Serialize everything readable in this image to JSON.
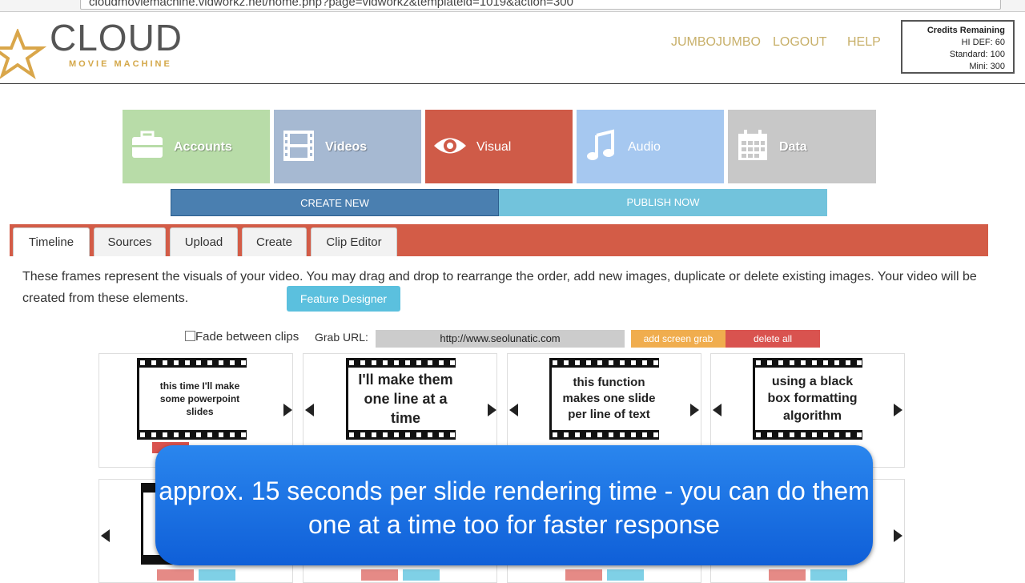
{
  "browser": {
    "url": "cloudmoviemachine.vidworkz.net/home.php?page=vidworkz&templateid=1019&action=300"
  },
  "logo": {
    "name": "CLOUD",
    "tagline": "MOVIE MACHINE"
  },
  "nav": {
    "user": "JUMBOJUMBO",
    "logout": "LOGOUT",
    "help": "HELP"
  },
  "credits": {
    "title": "Credits Remaining",
    "hidef": "HI DEF: 60",
    "standard": "Standard: 100",
    "mini": "Mini: 300"
  },
  "tiles": [
    {
      "label": "Accounts",
      "icon": "briefcase-icon",
      "color": "#b8dca8"
    },
    {
      "label": "Videos",
      "icon": "film-icon",
      "color": "#a6b9d2"
    },
    {
      "label": "Visual",
      "icon": "eye-icon",
      "color": "#cf5b48"
    },
    {
      "label": "Audio",
      "icon": "music-note-icon",
      "color": "#a6c8f0"
    },
    {
      "label": "Data",
      "icon": "calendar-icon",
      "color": "#c8c8c8"
    }
  ],
  "actions": {
    "create_new": "CREATE NEW",
    "publish_now": "PUBLISH NOW"
  },
  "tabs": [
    "Timeline",
    "Sources",
    "Upload",
    "Create",
    "Clip Editor"
  ],
  "description": "These frames represent the visuals of your video. You may drag and drop to rearrange the order, add new images, duplicate or delete existing images. Your video will be created from these elements.",
  "feature_designer": "Feature Designer",
  "controls": {
    "fade_label": "Fade between clips",
    "grab_label": "Grab URL:",
    "grab_value": "http://www.seolunatic.com",
    "add_screen_grab": "add screen grab",
    "delete_all": "delete all"
  },
  "frames": [
    "this time I'll make some powerpoint slides",
    "I'll make them one line at a time",
    "this function makes one slide per line of text",
    "using a black box formatting algorithm"
  ],
  "caption": "approx. 15 seconds per slide rendering time - you can do them one at a time too for faster response"
}
